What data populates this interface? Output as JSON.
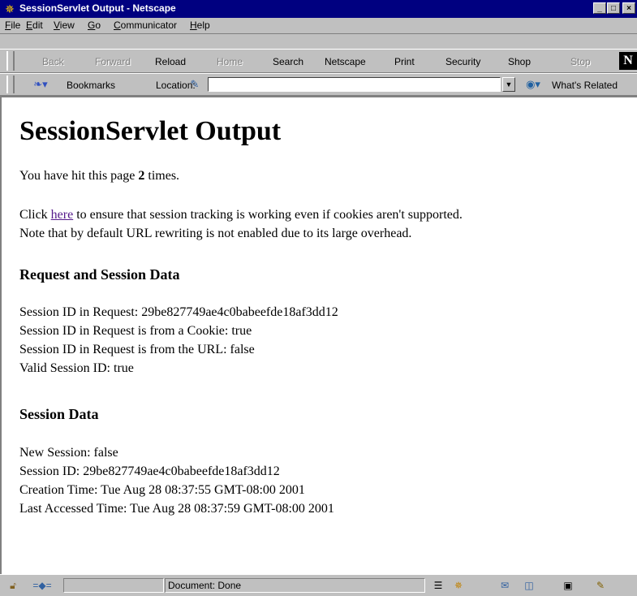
{
  "window": {
    "title": "SessionServlet Output - Netscape",
    "minimize_glyph": "_",
    "maximize_glyph": "□",
    "close_glyph": "×"
  },
  "menu": {
    "items": [
      {
        "mnemonic": "F",
        "rest": "ile"
      },
      {
        "mnemonic": "E",
        "rest": "dit"
      },
      {
        "mnemonic": "V",
        "rest": "iew"
      },
      {
        "mnemonic": "G",
        "rest": "o"
      },
      {
        "mnemonic": "C",
        "rest": "ommunicator"
      },
      {
        "mnemonic": "H",
        "rest": "elp"
      }
    ]
  },
  "navbar": {
    "back": "Back",
    "forward": "Forward",
    "reload": "Reload",
    "home": "Home",
    "search": "Search",
    "netscape": "Netscape",
    "print": "Print",
    "security": "Security",
    "shop": "Shop",
    "stop": "Stop",
    "logo_letter": "N"
  },
  "locbar": {
    "bookmarks": "Bookmarks",
    "location_label": "Location:",
    "location_value": "",
    "whats_related": "What's Related"
  },
  "page": {
    "heading": "SessionServlet Output",
    "hits_prefix": "You have hit this page ",
    "hits_count": "2",
    "hits_suffix": " times.",
    "click_prefix": "Click ",
    "click_link": "here",
    "click_suffix": " to ensure that session tracking is working even if cookies aren't supported.",
    "note": "Note that by default URL rewriting is not enabled due to its large overhead.",
    "request_heading": "Request and Session Data",
    "request_lines": [
      "Session ID in Request: 29be827749ae4c0babeefde18af3dd12",
      "Session ID in Request is from a Cookie: true",
      "Session ID in Request is from the URL: false",
      "Valid Session ID: true"
    ],
    "session_heading": "Session Data",
    "session_lines": [
      "New Session: false",
      "Session ID: 29be827749ae4c0babeefde18af3dd12",
      "Creation Time: Tue Aug 28 08:37:55 GMT-08:00 2001",
      "Last Accessed Time: Tue Aug 28 08:37:59 GMT-08:00 2001"
    ]
  },
  "status": {
    "text": "Document: Done"
  }
}
